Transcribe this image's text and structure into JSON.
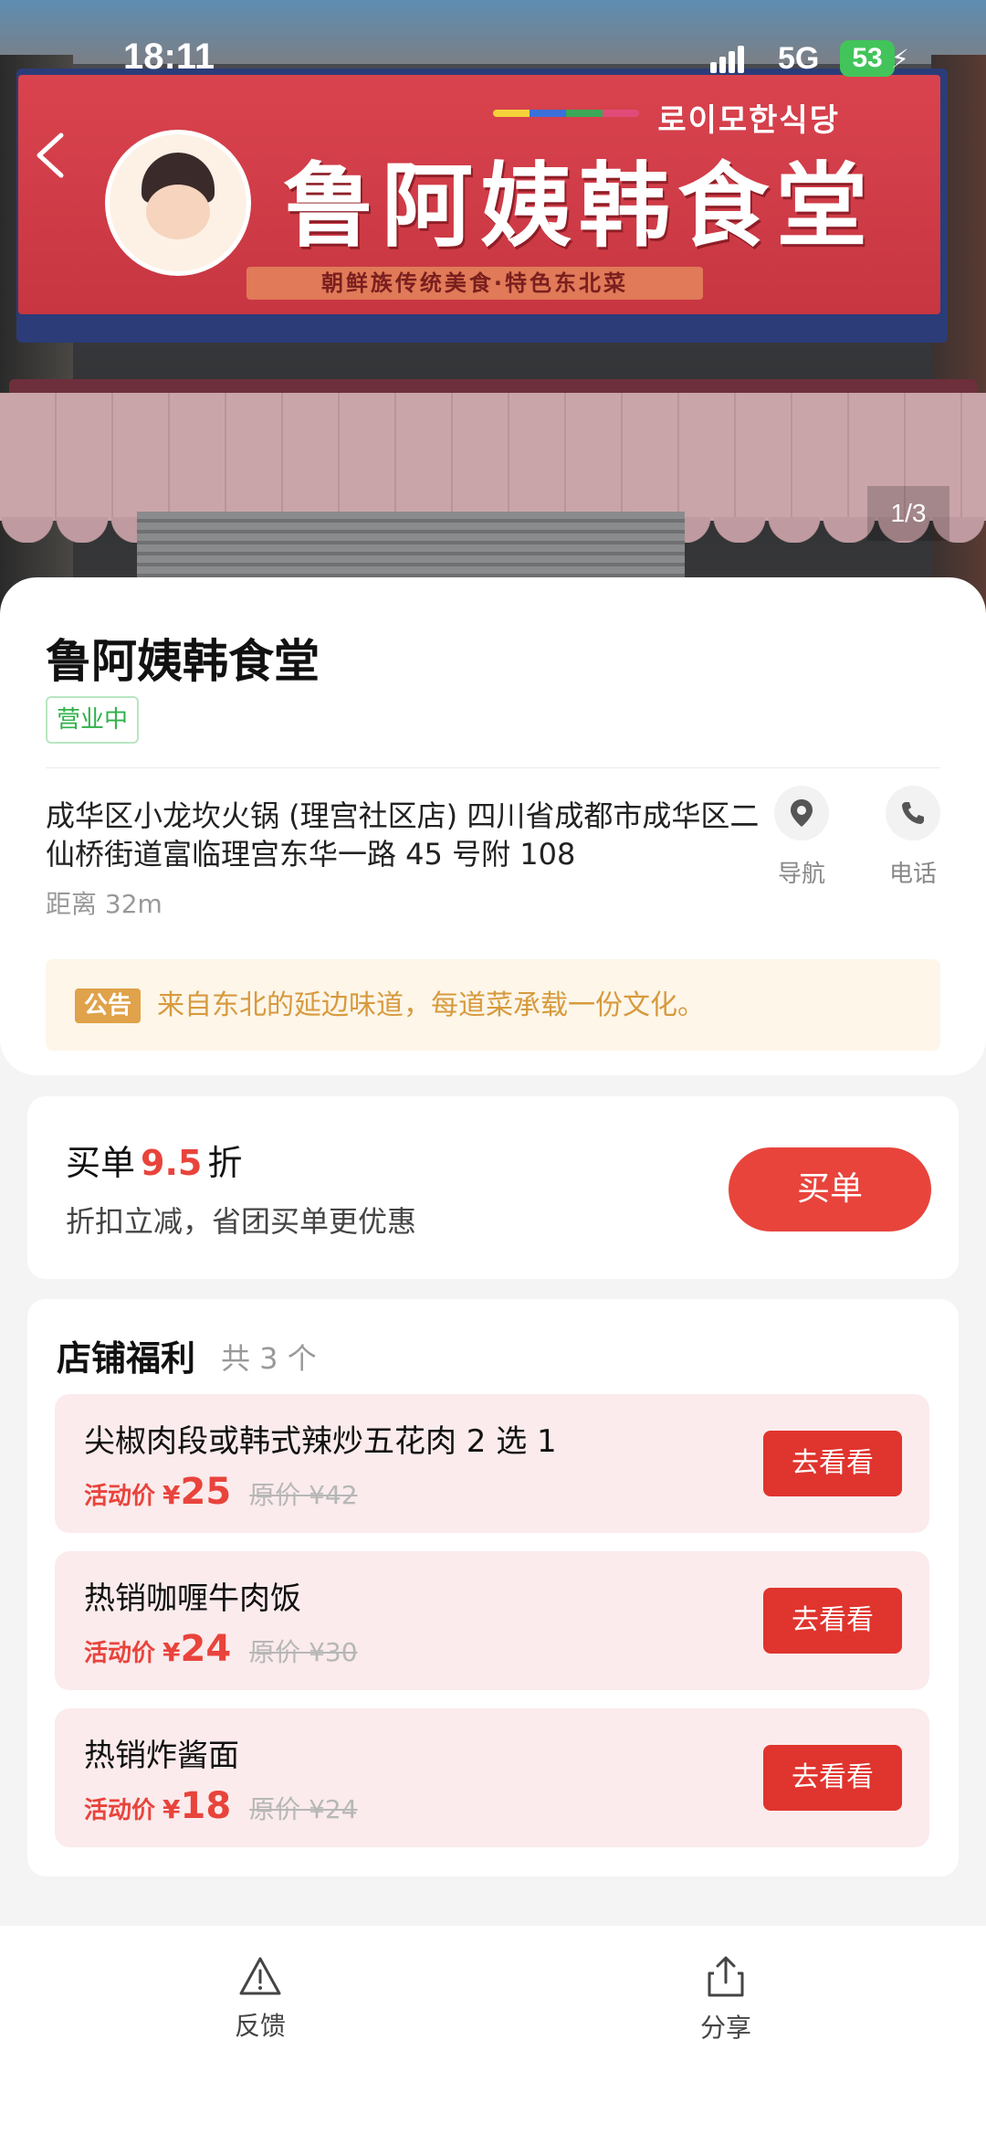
{
  "status_bar": {
    "time": "18:11",
    "network": "5G",
    "battery": "53"
  },
  "hero": {
    "photo_counter": "1/3",
    "sign_korean": "로이모한식당",
    "sign_name": "鲁阿姨韩食堂",
    "sign_slogan": "朝鲜族传统美食·特色东北菜"
  },
  "store": {
    "name": "鲁阿姨韩食堂",
    "status": "营业中",
    "address": "成华区小龙坎火锅 (理宫社区店) 四川省成都市成华区二仙桥街道富临理宫东华一路 45 号附 108",
    "distance": "距离 32m",
    "actions": [
      {
        "label": "导航",
        "icon": "location-pin-icon"
      },
      {
        "label": "电话",
        "icon": "phone-icon"
      }
    ],
    "notice": {
      "tag": "公告",
      "text": "来自东北的延边味道，每道菜承载一份文化。"
    }
  },
  "pay": {
    "title_prefix": "买单",
    "discount": "9.5",
    "title_suffix": "折",
    "subtitle": "折扣立减，省团买单更优惠",
    "button": "买单"
  },
  "benefits": {
    "title": "店铺福利",
    "count": "共 3 个",
    "deals": [
      {
        "name": "尖椒肉段或韩式辣炒五花肉 2 选 1",
        "act_label": "活动价",
        "price": "25",
        "orig": "原价 ¥42",
        "button": "去看看"
      },
      {
        "name": "热销咖喱牛肉饭",
        "act_label": "活动价",
        "price": "24",
        "orig": "原价 ¥30",
        "button": "去看看"
      },
      {
        "name": "热销炸酱面",
        "act_label": "活动价",
        "price": "18",
        "orig": "原价 ¥24",
        "button": "去看看"
      }
    ]
  },
  "bottom_bar": {
    "feedback": "反馈",
    "share": "分享"
  },
  "colors": {
    "accent_red": "#e8443c",
    "open_green": "#2fb14a",
    "notice_orange": "#d79a3e"
  }
}
